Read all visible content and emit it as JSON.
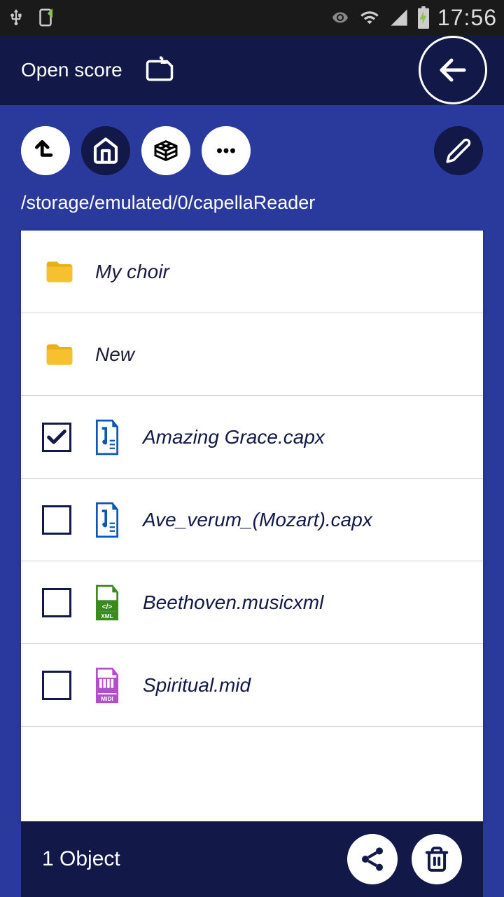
{
  "status": {
    "time": "17:56"
  },
  "appbar": {
    "title": "Open score"
  },
  "path": "/storage/emulated/0/capellaReader",
  "items": [
    {
      "type": "folder",
      "name": "My choir",
      "checked": false
    },
    {
      "type": "folder",
      "name": "New",
      "checked": false
    },
    {
      "type": "capx",
      "name": "Amazing Grace.capx",
      "checked": true
    },
    {
      "type": "capx",
      "name": "Ave_verum_(Mozart).capx",
      "checked": false
    },
    {
      "type": "xml",
      "name": "Beethoven.musicxml",
      "checked": false
    },
    {
      "type": "midi",
      "name": "Spiritual.mid",
      "checked": false
    }
  ],
  "bottom": {
    "count_label": "1 Object"
  }
}
